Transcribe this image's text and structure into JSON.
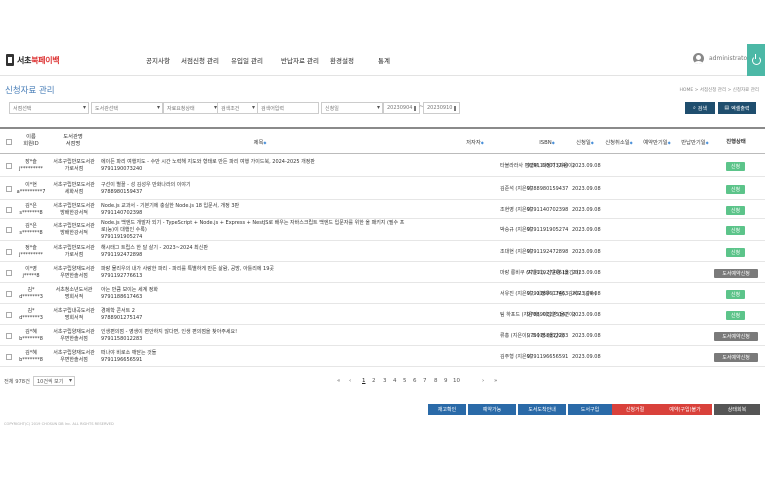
{
  "app": {
    "logo_text_a": "서초",
    "logo_text_b": "북페이백"
  },
  "nav": [
    "공지사항",
    "서점신청 관리",
    "유입일 관리",
    "반납자료 관리",
    "환경설정",
    "통계"
  ],
  "user": {
    "name": "administrator"
  },
  "page": {
    "title": "신청자료 관리",
    "breadcrumb": "HOME > 서점신청 관리 > 신청자료 관리"
  },
  "filters": {
    "store_select": "서점선택",
    "library_select": "도서관선택",
    "status_select": "자료요청상태",
    "search_cond": "검색조건",
    "search_placeholder": "검색어입력",
    "date_type": "신청일",
    "date_from": "20230904",
    "date_to": "20230910",
    "search_button": "검색",
    "excel_button": "엑셀출력"
  },
  "table": {
    "headers": {
      "name": "이름",
      "member_id": "회원ID",
      "library": "도서관명",
      "store": "서점명",
      "title": "제목",
      "author": "저자자",
      "isbn": "ISBN",
      "apply_date": "신청일",
      "cancel_date": "신청취소일",
      "reserve_date": "예약만기일",
      "return_date": "반납만기일",
      "status": "진행상태"
    },
    "rows": [
      {
        "name": "장*슬",
        "id": "j*********",
        "library": "서초구립반포도서관",
        "store": "가로서점",
        "title": "에이든 파리 여행지도 - 수만 시간 노력해 지도와 형태로 만든 파리 여행 가이드북, 2024-2025 개정판",
        "isbn_line": "9791190073240",
        "author": "타블라라사 편집부, 이정기 (지은이)",
        "isbn": "9791190073240",
        "date": "2023.09.08",
        "status": "신청",
        "status_type": "green"
      },
      {
        "name": "이*현",
        "id": "a*********7",
        "library": "서초구립반포도서관",
        "store": "세화서점",
        "title": "구선이 별꼴 - 성 김성우 만화나라의 이야기",
        "isbn_line": "9788980159437",
        "author": "김준석 (지은이)",
        "isbn": "9788980159437",
        "date": "2023.09.08",
        "status": "신청",
        "status_type": "green"
      },
      {
        "name": "김*은",
        "id": "s*******8",
        "library": "서초구립반포도서관",
        "store": "방배한강서적",
        "title": "Node.js 교과서 - 기본기에 충실한 Node.js 18 입문서, 개정 3판",
        "isbn_line": "9791140702398",
        "author": "조현영 (지은이)",
        "isbn": "9791140702398",
        "date": "2023.09.08",
        "status": "신청",
        "status_type": "green"
      },
      {
        "name": "김*은",
        "id": "s*******8",
        "library": "서초구립반포도서관",
        "store": "방배한강서적",
        "title": "Node.js 백엔드 개발자 되기 - TypeScript + Node.js + Express + NestJS로 배우는 자바스크립트 백엔드 입문자를 위한 올 패키지 (필수 프",
        "title2": "로(능)이 대행인 수록)",
        "isbn_line": "9791191905274",
        "author": "박승규 (지은이)",
        "isbn": "9791191905274",
        "date": "2023.09.08",
        "status": "신청",
        "status_type": "green"
      },
      {
        "name": "정*슬",
        "id": "j*********",
        "library": "서초구립반포도서관",
        "store": "가로서점",
        "title": "해시태그 트립스 한 달 살기 - 2023~2024 최신판",
        "isbn_line": "9791192472898",
        "author": "조대현 (지은이)",
        "isbn": "9791192472898",
        "date": "2023.09.08",
        "status": "신청",
        "status_type": "green"
      },
      {
        "name": "이*영",
        "id": "j*****8",
        "library": "서초구립양재도서관",
        "store": "우면한솔서점",
        "title": "파랑 물리우의 내가 사랑한 파리 - 파리를 특별하게 만든 삶람, 공방, 아틀리에 19곳",
        "isbn_line": "9791192776613",
        "author": "마랑 롱비쿠 (지은이), 신윤경 (옮긴이)",
        "isbn": "9791192776613",
        "date": "2023.09.08",
        "status": "도서예약신청",
        "status_type": "gray"
      },
      {
        "name": "김*",
        "id": "d*******3",
        "library": "서초청소년도서관",
        "store": "명희서적",
        "title": "아는 만큼 보이는 세계 정화",
        "isbn_line": "9791188617463",
        "author": "서유진 (지은이), 이정우 (그림), 김석모 (감수)",
        "isbn": "9791188617463",
        "date": "2023.09.08",
        "status": "신청",
        "status_type": "green"
      },
      {
        "name": "김*",
        "id": "d*******3",
        "library": "서초구립내곡도서관",
        "store": "명희서적",
        "title": "경제학 콘서트 2",
        "isbn_line": "9788901275147",
        "author": "팀 하포드 (지은이), 이진원 (옮긴이)",
        "isbn": "9788901275147",
        "date": "2023.09.08",
        "status": "신청",
        "status_type": "green"
      },
      {
        "name": "김*혜",
        "id": "b*******8",
        "library": "서초구립양재도서관",
        "store": "우면한솔서점",
        "title": "인생편의점 - 영생이 편안하지 않다면, 인생 편의점을 찾아주세요!",
        "isbn_line": "9791158012283",
        "author": "류홍 (지은이), 조수정 (옮긴이)",
        "isbn": "9791158012283",
        "date": "2023.09.08",
        "status": "도서예약신청",
        "status_type": "gray"
      },
      {
        "name": "김*혜",
        "id": "b*******8",
        "library": "서초구립양재도서관",
        "store": "우면한솔서점",
        "title": "떠나야 비로소 깨닫는 것들",
        "isbn_line": "9791196656591",
        "author": "김주형 (지은이)",
        "isbn": "9791196656591",
        "date": "2023.09.08",
        "status": "도서예약신청",
        "status_type": "gray"
      }
    ]
  },
  "pager": {
    "total": "전체 978건",
    "page_size": "10건씩 보기",
    "first": "«",
    "prev": "‹",
    "pages": [
      "1",
      "2",
      "3",
      "4",
      "5",
      "6",
      "7",
      "8",
      "9",
      "10"
    ],
    "next": "›",
    "last": "»"
  },
  "actions": [
    {
      "label": "재고확인",
      "color": "#2a6aa8"
    },
    {
      "label": "예약가능",
      "color": "#2a6aa8"
    },
    {
      "label": "도서도착안내",
      "color": "#2a6aa8"
    },
    {
      "label": "도서구입",
      "color": "#2a6aa8"
    },
    {
      "label": "신청거절",
      "color": "#d9413b"
    },
    {
      "label": "예약(구입)불가",
      "color": "#d9413b"
    },
    {
      "label": "상태회복",
      "color": "#555555"
    }
  ],
  "footer": {
    "copyright": "COPYRIGHT(C) 2019 CHOSUN DB Inc. ALL RIGHTS RESERVED"
  }
}
